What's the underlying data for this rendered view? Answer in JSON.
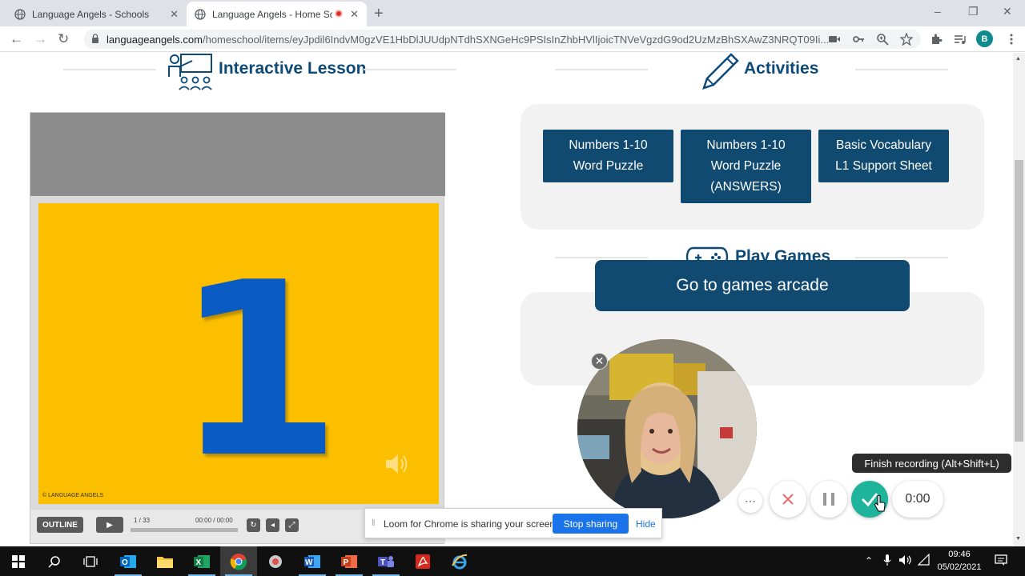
{
  "browser": {
    "tabs": [
      {
        "title": "Language Angels - Schools",
        "active": false
      },
      {
        "title": "Language Angels - Home Sc",
        "active": true,
        "recording": true
      }
    ],
    "new_tab_label": "+",
    "window_controls": {
      "minimize": "–",
      "maximize": "❐",
      "close": "✕"
    },
    "url_host": "languageangels.com",
    "url_path": "/homeschool/items/eyJpdil6IndvM0gzVE1HbDlJUUdpNTdhSXNGeHc9PSIsInZhbHVlIjoicTNVeVgzdG9od2UzMzBhSXAwZ3NRQT09Ii...",
    "profile_initial": "B"
  },
  "page": {
    "lesson_heading": "Interactive Lesson",
    "activities_heading": "Activities",
    "games_heading": "Play Games",
    "activity_buttons": [
      {
        "line1": "Numbers 1-10",
        "line2": "Word Puzzle",
        "line3": ""
      },
      {
        "line1": "Numbers 1-10",
        "line2": "Word Puzzle",
        "line3": "(ANSWERS)"
      },
      {
        "line1": "Basic Vocabulary",
        "line2": "L1 Support Sheet",
        "line3": ""
      }
    ],
    "arcade_button": "Go to games arcade"
  },
  "player": {
    "slide_number": "1",
    "logo_text": "© LANGUAGE ANGELS",
    "outline_label": "OUTLINE",
    "slide_counter": "1 / 33",
    "time": "00:00 / 00:00",
    "progress": 0.0
  },
  "loom": {
    "tooltip": "Finish recording (Alt+Shift+L)",
    "timer": "0:00",
    "more_label": "⋯",
    "share_message": "Loom for Chrome is sharing your screen.",
    "stop_sharing": "Stop sharing",
    "hide": "Hide"
  },
  "taskbar": {
    "time": "09:46",
    "date": "05/02/2021",
    "apps": [
      "start-icon",
      "search-icon",
      "task-view-icon",
      "outlook-icon",
      "file-explorer-icon",
      "excel-icon",
      "chrome-icon",
      "app-icon",
      "word-icon",
      "powerpoint-icon",
      "teams-icon",
      "acrobat-icon",
      "edge-icon"
    ]
  },
  "colors": {
    "brand_navy": "#114a70",
    "heading_blue": "#0d4a78",
    "slide_yellow": "#fbbf00",
    "number_blue": "#0b5bc4",
    "loom_teal": "#1eb39b"
  }
}
